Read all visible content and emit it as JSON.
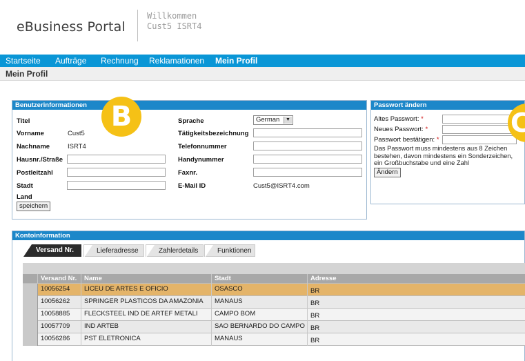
{
  "header": {
    "brand": "eBusiness Portal",
    "welcome_line1": "Willkommen",
    "welcome_line2": "Cust5 ISRT4"
  },
  "nav": {
    "items": [
      "Startseite",
      "Aufträge",
      "Rechnung",
      "Reklamationen",
      "Mein Profil"
    ],
    "active_index": 4
  },
  "page_title": "Mein Profil",
  "badges": [
    "B",
    "C"
  ],
  "benutzer": {
    "title": "Benutzerinformationen",
    "titel_label": "Titel",
    "vorname_label": "Vorname",
    "vorname_value": "Cust5",
    "nachname_label": "Nachname",
    "nachname_value": "ISRT4",
    "hausnr_label": "Hausnr./Straße",
    "postleitzahl_label": "Postleitzahl",
    "stadt_label": "Stadt",
    "land_label": "Land",
    "save_button": "speichern",
    "sprache_label": "Sprache",
    "sprache_value": "German",
    "taetigkeit_label": "Tätigkeitsbezeichnung",
    "telefon_label": "Telefonnummer",
    "handy_label": "Handynummer",
    "fax_label": "Faxnr.",
    "email_label": "E-Mail ID",
    "email_value": "Cust5@ISRT4.com"
  },
  "passwort": {
    "title": "Passwort ändern",
    "alt_label": "Altes Passwort:",
    "neu_label": "Neues Passwort:",
    "bestaetigen_label": "Passwort bestätigen:",
    "required_mark": "*",
    "hint_line1": "Das Passwort muss mindestens aus 8 Zeichen",
    "hint_line2": "bestehen, davon mindestens ein Sonderzeichen,",
    "hint_line3": "ein Großbuchstabe und eine Zahl",
    "change_button": "Ändern"
  },
  "konto": {
    "title": "Kontoinformation",
    "tabs": [
      "Versand Nr.",
      "Lieferadresse",
      "Zahlerdetails",
      "Funktionen"
    ],
    "active_tab": 0,
    "columns": [
      "Versand Nr.",
      "Name",
      "Stadt",
      "Adresse"
    ],
    "rows": [
      {
        "nr": "10056254",
        "name": "LICEU DE ARTES E OFICIO",
        "stadt": "OSASCO",
        "adresse": "BR"
      },
      {
        "nr": "10056262",
        "name": "SPRINGER PLASTICOS DA AMAZONIA",
        "stadt": "MANAUS",
        "adresse": "BR"
      },
      {
        "nr": "10058885",
        "name": "FLECKSTEEL IND DE ARTEF METALI",
        "stadt": "CAMPO BOM",
        "adresse": "BR"
      },
      {
        "nr": "10057709",
        "name": "IND ARTEB",
        "stadt": "SAO BERNARDO DO CAMPO",
        "adresse": "BR"
      },
      {
        "nr": "10056286",
        "name": "PST ELETRONICA",
        "stadt": "MANAUS",
        "adresse": "BR"
      }
    ],
    "highlight_row": 0
  },
  "colors": {
    "nav_blue": "#0a96d6",
    "panel_header_blue": "#1c87c9",
    "highlight_row": "#e4b469",
    "badge_yellow": "#f5c116"
  }
}
